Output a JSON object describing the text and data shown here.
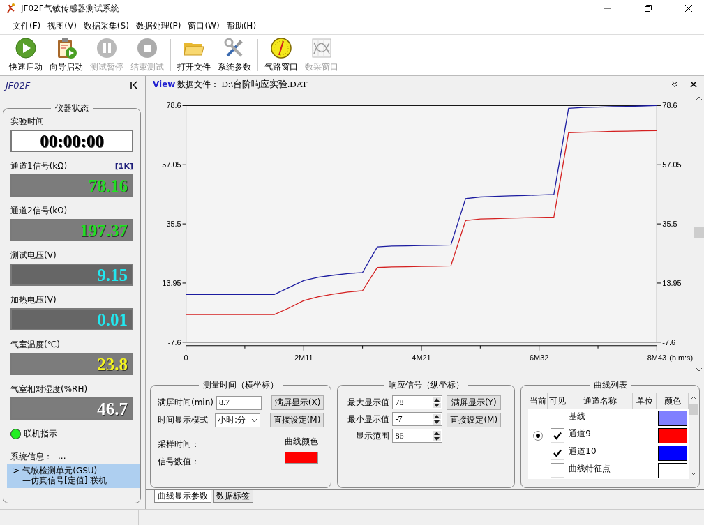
{
  "window": {
    "title": "JF02F气敏传感器测试系统"
  },
  "menu": [
    "文件(F)",
    "视图(V)",
    "数据采集(S)",
    "数据处理(P)",
    "窗口(W)",
    "帮助(H)"
  ],
  "toolbar": [
    [
      {
        "label": "快速启动",
        "kind": "play",
        "disabled": false
      },
      {
        "label": "向导启动",
        "kind": "wizard",
        "disabled": false
      },
      {
        "label": "测试暂停",
        "kind": "pause",
        "disabled": true
      },
      {
        "label": "结束测试",
        "kind": "stop",
        "disabled": true
      }
    ],
    [
      {
        "label": "打开文件",
        "kind": "folder",
        "disabled": false
      },
      {
        "label": "系统参数",
        "kind": "tools",
        "disabled": false
      }
    ],
    [
      {
        "label": "气路窗口",
        "kind": "gauge",
        "disabled": false
      },
      {
        "label": "数采窗口",
        "kind": "chart",
        "disabled": true
      }
    ]
  ],
  "sidebar": {
    "title": "JF02F",
    "group_title": "仪器状态",
    "readouts": [
      {
        "label": "实验时间",
        "value": "00:00:00",
        "kind": "clock",
        "color": "#000000"
      },
      {
        "label": "通道1信号(kΩ)",
        "badge": "[1K]",
        "value": "78.16",
        "kind": "light",
        "color": "#22e022"
      },
      {
        "label": "通道2信号(kΩ)",
        "value": "197.37",
        "kind": "light",
        "color": "#22e022"
      },
      {
        "label": "测试电压(V)",
        "value": "9.15",
        "kind": "dark",
        "color": "#22e8f0"
      },
      {
        "label": "加热电压(V)",
        "value": "0.01",
        "kind": "dark",
        "color": "#22e8f0"
      },
      {
        "label": "气室温度(℃)",
        "value": "23.8",
        "kind": "light",
        "color": "#f4f422"
      },
      {
        "label": "气室相对湿度(%RH)",
        "value": "46.7",
        "kind": "light",
        "color": "#ffffff"
      }
    ],
    "indicator": {
      "label": "联机指示",
      "on": true
    },
    "system_info": {
      "label": "系统信息：",
      "value": "...",
      "messages": [
        "-> 气敏检测单元(GSU)",
        "—仿真信号[定值] 联机"
      ]
    }
  },
  "view": {
    "title": "View",
    "file_label": "数据文件：",
    "file_path": "D:\\台阶响应实验.DAT",
    "chart_data": {
      "type": "line",
      "categories": [
        "0",
        null,
        null,
        null,
        null,
        null,
        null,
        null,
        "2M11",
        null,
        null,
        null,
        null,
        null,
        null,
        null,
        "4M21",
        null,
        null,
        null,
        null,
        null,
        null,
        null,
        "6M32",
        null,
        null,
        null,
        null,
        null,
        null,
        null,
        "8M43"
      ],
      "series": [
        {
          "color": "#1c1ca0",
          "values": [
            9.8,
            9.8,
            9.8,
            9.8,
            9.8,
            9.8,
            9.8,
            12.3,
            14.85,
            16.1,
            16.8,
            17.4,
            17.8,
            27.1,
            27.4,
            27.5,
            27.6,
            27.7,
            27.8,
            44.7,
            45.3,
            45.5,
            45.7,
            45.85,
            46.0,
            46.2,
            77.6,
            77.9,
            78.05,
            78.2,
            78.3,
            78.45,
            78.6
          ]
        },
        {
          "color": "#d42020",
          "values": [
            2.5,
            2.5,
            2.5,
            2.5,
            2.5,
            2.5,
            2.5,
            4.85,
            7.57,
            8.95,
            9.9,
            10.65,
            11.2,
            19.6,
            19.8,
            19.9,
            20.0,
            20.1,
            20.2,
            36.7,
            37.3,
            37.4,
            37.6,
            37.75,
            37.85,
            38.0,
            68.7,
            68.9,
            69.05,
            69.2,
            69.3,
            69.4,
            69.5
          ]
        }
      ],
      "ylim": [
        -7.6,
        78.6
      ],
      "yticks": [
        -7.6,
        13.95,
        35.5,
        57.05,
        78.6
      ],
      "y2ticks": [
        -7.6,
        13.95,
        35.5,
        57.05,
        78.6
      ],
      "y2lim": [
        -7.6,
        78.6
      ],
      "xlabel": "(h:m:s)"
    }
  },
  "time_panel": {
    "title": "测量时间（横坐标）",
    "fullscreen_label": "满屏时间(min)",
    "fullscreen_value": "8.7",
    "mode_label": "时间显示模式",
    "mode_value": "小时:分",
    "buttons": [
      "满屏显示(X)",
      "直接设定(M)"
    ],
    "sample_label": "采样时间：",
    "signal_label": "信号数值：",
    "color_label": "曲线颜色",
    "color": "#ff0000"
  },
  "signal_panel": {
    "title": "响应信号（纵坐标）",
    "fields": [
      {
        "label": "最大显示值",
        "value": "78"
      },
      {
        "label": "最小显示值",
        "value": "-7"
      },
      {
        "label": "显示范围",
        "value": "86"
      }
    ],
    "buttons": [
      "满屏显示(Y)",
      "直接设定(M)"
    ]
  },
  "curve_list": {
    "title": "曲线列表",
    "columns": [
      "当前",
      "可见",
      "通道名称",
      "单位",
      "颜色"
    ],
    "rows": [
      {
        "name": "基线",
        "selected": false,
        "checked": false,
        "color": "#8080ff"
      },
      {
        "name": "通道9",
        "selected": true,
        "checked": true,
        "color": "#ff0000"
      },
      {
        "name": "通道10",
        "selected": false,
        "checked": true,
        "color": "#0000ff"
      },
      {
        "name": "曲线特征点",
        "selected": false,
        "checked": false,
        "color": "#ffffff"
      }
    ]
  },
  "tabs": [
    {
      "label": "曲线显示参数",
      "selected": true
    },
    {
      "label": "数据标签",
      "selected": false
    }
  ]
}
